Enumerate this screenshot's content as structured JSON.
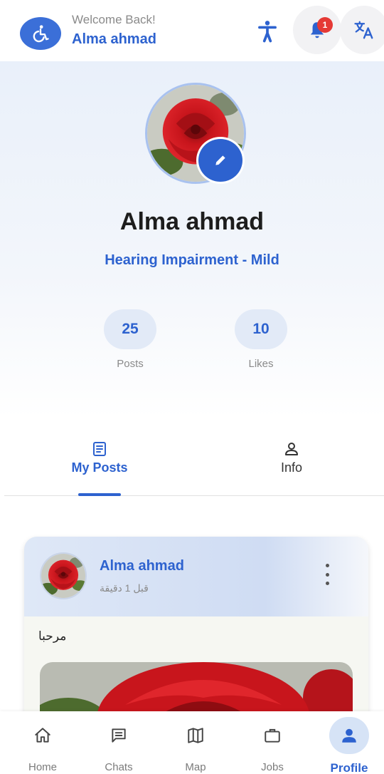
{
  "header": {
    "welcome": "Welcome Back!",
    "username": "Alma ahmad",
    "notification_count": "1",
    "icons": [
      "accessibility-icon",
      "bell-icon",
      "translate-icon"
    ]
  },
  "profile": {
    "name": "Alma ahmad",
    "subtitle": "Hearing Impairment - Mild",
    "stats": [
      {
        "value": "25",
        "label": "Posts"
      },
      {
        "value": "10",
        "label": "Likes"
      }
    ]
  },
  "tabs": [
    {
      "label": "My Posts",
      "active": true
    },
    {
      "label": "Info",
      "active": false
    }
  ],
  "post": {
    "author": "Alma ahmad",
    "time": "قبل 1 دقيقة",
    "text": "مرحبا"
  },
  "nav": [
    {
      "label": "Home"
    },
    {
      "label": "Chats"
    },
    {
      "label": "Map"
    },
    {
      "label": "Jobs"
    },
    {
      "label": "Profile",
      "active": true
    }
  ],
  "colors": {
    "accent": "#2d62cf",
    "pill": "#e2eaf7",
    "badge": "#e53935"
  }
}
